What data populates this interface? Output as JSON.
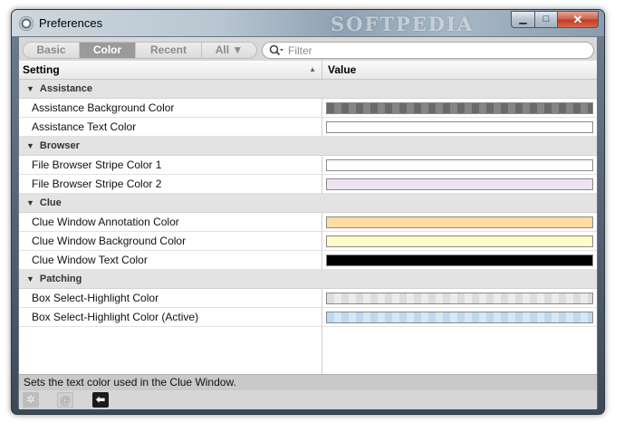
{
  "window": {
    "title": "Preferences",
    "watermark": "SOFTPEDIA",
    "controls": {
      "minimize": "▁",
      "maximize": "□",
      "close": "✕"
    }
  },
  "tabs": [
    {
      "label": "Basic"
    },
    {
      "label": "Color"
    },
    {
      "label": "Recent"
    },
    {
      "label": "All ▼"
    }
  ],
  "active_tab": "Color",
  "filter": {
    "placeholder": "Filter",
    "value": "",
    "icon": "search-icon"
  },
  "table": {
    "headers": {
      "setting": "Setting",
      "value": "Value"
    },
    "sort_indicator": "▲",
    "groups": [
      {
        "name": "Assistance",
        "rows": [
          {
            "label": "Assistance Background Color",
            "swatch": "#6a6a6a",
            "pattern": "checker-dark"
          },
          {
            "label": "Assistance Text Color",
            "swatch": "#ffffff",
            "pattern": "solid"
          }
        ]
      },
      {
        "name": "Browser",
        "rows": [
          {
            "label": "File Browser Stripe Color 1",
            "swatch": "#ffffff",
            "pattern": "solid"
          },
          {
            "label": "File Browser Stripe Color 2",
            "swatch": "#ede4f0",
            "pattern": "solid"
          }
        ]
      },
      {
        "name": "Clue",
        "rows": [
          {
            "label": "Clue Window Annotation Color",
            "swatch": "#ffdca0",
            "pattern": "solid"
          },
          {
            "label": "Clue Window Background Color",
            "swatch": "#fefcc8",
            "pattern": "solid"
          },
          {
            "label": "Clue Window Text Color",
            "swatch": "#000000",
            "pattern": "solid"
          }
        ]
      },
      {
        "name": "Patching",
        "rows": [
          {
            "label": "Box Select-Highlight Color",
            "swatch": "#dcdcdc",
            "pattern": "checker-light"
          },
          {
            "label": "Box Select-Highlight Color (Active)",
            "swatch": "#bcd9ef",
            "pattern": "checker-blue"
          }
        ]
      }
    ]
  },
  "status": {
    "text": "Sets the text color used in the Clue Window."
  },
  "bottom_icons": [
    {
      "name": "gear-icon",
      "glyph": "✲"
    },
    {
      "name": "at-icon",
      "glyph": "@"
    },
    {
      "name": "back-arrow-icon",
      "glyph": "⬅"
    }
  ]
}
